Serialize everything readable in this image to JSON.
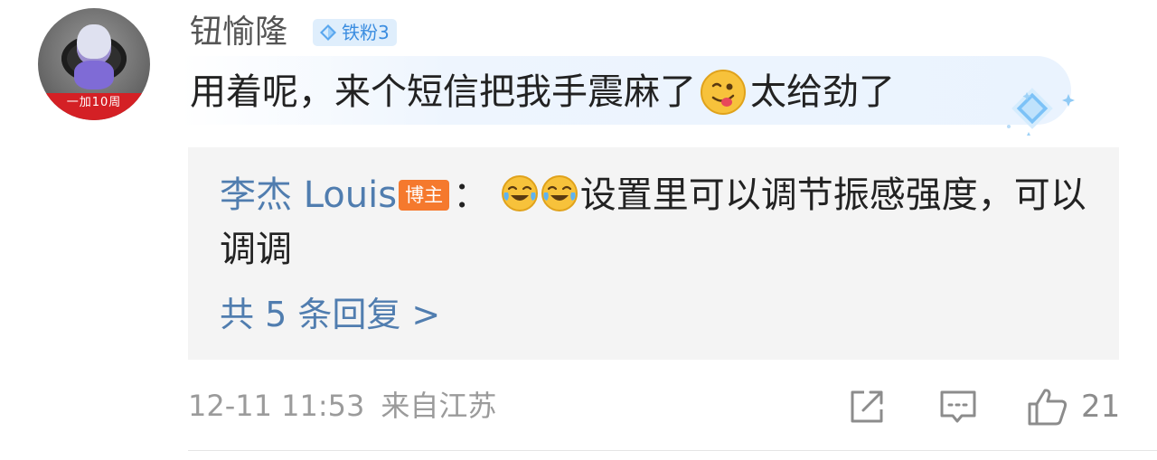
{
  "comment": {
    "avatar_caption": "一加10周",
    "username": "钮愉隆",
    "fan_badge": "铁粉3",
    "text_before_emoji": "用着呢，来个短信把我手震麻了",
    "text_after_emoji": "太给劲了"
  },
  "reply": {
    "author": "李杰 Louis",
    "author_badge": "博主",
    "separator": "：",
    "text": "设置里可以调节振感强度，可以调调",
    "more_label": "共 5 条回复 >"
  },
  "footer": {
    "date": "12-11 11:53",
    "location": "来自江苏",
    "like_count": "21"
  },
  "colors": {
    "link_blue": "#507daf",
    "badge_orange": "#f5792d",
    "fan_badge_bg": "#dfeefc",
    "fan_badge_text": "#3b8de0",
    "meta_gray": "#9b9b9b"
  },
  "icons": {
    "fan_badge_icon": "diamond-icon",
    "comment_emoji": "licking-lips-emoji",
    "reply_emoji": "laughing-tears-emoji",
    "decoration": "diamond-sparkle-icon",
    "share": "share-external-icon",
    "comment": "comment-bubble-icon",
    "like": "thumbs-up-icon"
  }
}
